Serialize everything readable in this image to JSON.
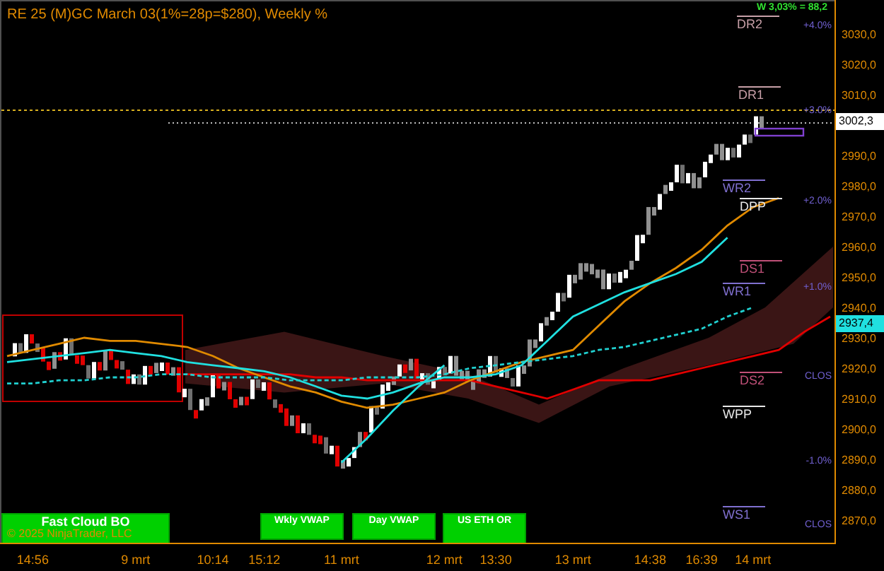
{
  "title": "RE 25 (M)GC March 03(1%=28p=$280), Weekly %",
  "stat": "W 3,03% = 88,2",
  "chart": {
    "chart_data": {
      "type": "line",
      "categories": [
        null,
        "14:56",
        null,
        null,
        null,
        "9 mrt",
        null,
        null,
        "10:14",
        null,
        "15:12",
        null,
        null,
        "11 mrt",
        null,
        null,
        null,
        "12 mrt",
        null,
        "13:30",
        null,
        null,
        "13 mrt",
        null,
        null,
        "14:38",
        null,
        "16:39",
        null,
        "14 mrt",
        null,
        null,
        null
      ],
      "ylim": [
        2862.1,
        3040.7
      ],
      "yticks": [
        {
          "value": 3030,
          "label": "3030,0"
        },
        {
          "value": 3020,
          "label": "3020,0"
        },
        {
          "value": 3010,
          "label": "3010,0"
        },
        {
          "value": 2990,
          "label": "2990,0"
        },
        {
          "value": 2980,
          "label": "2980,0"
        },
        {
          "value": 2970,
          "label": "2970,0"
        },
        {
          "value": 2960,
          "label": "2960,0"
        },
        {
          "value": 2950,
          "label": "2950,0"
        },
        {
          "value": 2940,
          "label": "2940,0"
        },
        {
          "value": 2930,
          "label": "2930,0"
        },
        {
          "value": 2920,
          "label": "2920,0"
        },
        {
          "value": 2910,
          "label": "2910,0"
        },
        {
          "value": 2900,
          "label": "2900,0"
        },
        {
          "value": 2890,
          "label": "2890,0"
        },
        {
          "value": 2880,
          "label": "2880,0"
        },
        {
          "value": 2870,
          "label": "2870,0"
        }
      ],
      "series": [
        {
          "color": "#e00000",
          "line_style": "solid",
          "values": [
            null,
            null,
            null,
            null,
            null,
            null,
            null,
            2918,
            2918,
            2918,
            2918,
            2918,
            2917,
            2917,
            2916,
            2916,
            2916,
            2916,
            2916,
            2914,
            2912,
            2910,
            2913,
            2916,
            2916,
            2916,
            2918,
            2920,
            2922,
            2924,
            2926,
            2932,
            2937
          ]
        },
        {
          "color": "#e08a00",
          "line_style": "solid",
          "values": [
            2924,
            2926,
            2928,
            2930,
            2929,
            2929,
            2928,
            2927,
            2924,
            2920,
            2917,
            2914,
            2912,
            2909,
            2907,
            2908,
            2910,
            2912,
            2916,
            2919,
            2922,
            2924,
            2926,
            2934,
            2942,
            2948,
            2953,
            2959,
            2967,
            2973,
            2976,
            null,
            null
          ]
        },
        {
          "color": "#20e0e0",
          "line_style": "solid",
          "values": [
            2922,
            2923,
            2924,
            2925,
            2926,
            2925,
            2924,
            2922,
            2921,
            2920,
            2919,
            2917,
            2914,
            2911,
            2910,
            2912,
            2915,
            2917,
            2917,
            2918,
            2921,
            2929,
            2937,
            2941,
            2945,
            2948,
            2951,
            2955,
            2963,
            null,
            null,
            null,
            null
          ]
        },
        {
          "color": "#20e0e0",
          "line_style": "solid",
          "values": [
            null,
            null,
            null,
            null,
            null,
            null,
            null,
            null,
            null,
            null,
            null,
            null,
            null,
            2889,
            2897,
            2906,
            2914,
            2921,
            null,
            null,
            null,
            null,
            null,
            null,
            null,
            null,
            null,
            null,
            null,
            null,
            null,
            null,
            null
          ]
        },
        {
          "color": "#20d0d0",
          "line_style": "dashed",
          "values": [
            2915,
            2915,
            2916,
            2916,
            2917,
            2917,
            2918,
            2918,
            2917,
            2917,
            2917,
            2916,
            2916,
            2916,
            2917,
            2917,
            2917,
            2918,
            2920,
            2921,
            2922,
            2923,
            2924,
            2926,
            2927,
            2929,
            2931,
            2933,
            2937,
            2940,
            null,
            null,
            null
          ]
        }
      ]
    }
  },
  "price_axis": {
    "last_price": "3002,3",
    "indicator_price": "2937,4"
  },
  "levels": [
    {
      "label": "DR2",
      "color": "#c8a0a8"
    },
    {
      "label": "DR1",
      "color": "#c8a0a8"
    },
    {
      "label": "WR2",
      "color": "#8070d0"
    },
    {
      "label": "DPP",
      "color": "#e8e8e8"
    },
    {
      "label": "DS1",
      "color": "#c05078"
    },
    {
      "label": "WR1",
      "color": "#8070d0"
    },
    {
      "label": "DS2",
      "color": "#c05078"
    },
    {
      "label": "WPP",
      "color": "#e8e8e8"
    },
    {
      "label": "WS1",
      "color": "#8070d0"
    }
  ],
  "percent_labels": [
    "+4.0%",
    "+3.0%",
    "+2.0%",
    "+1.0%",
    "CLOS",
    "-1.0%",
    "CLOS"
  ],
  "buttons": [
    {
      "label": "Fast Cloud BO"
    },
    {
      "label": "Wkly VWAP"
    },
    {
      "label": "Day VWAP"
    },
    {
      "label": "US ETH OR"
    }
  ],
  "copyright": "© 2025 NinjaTrader, LLC"
}
